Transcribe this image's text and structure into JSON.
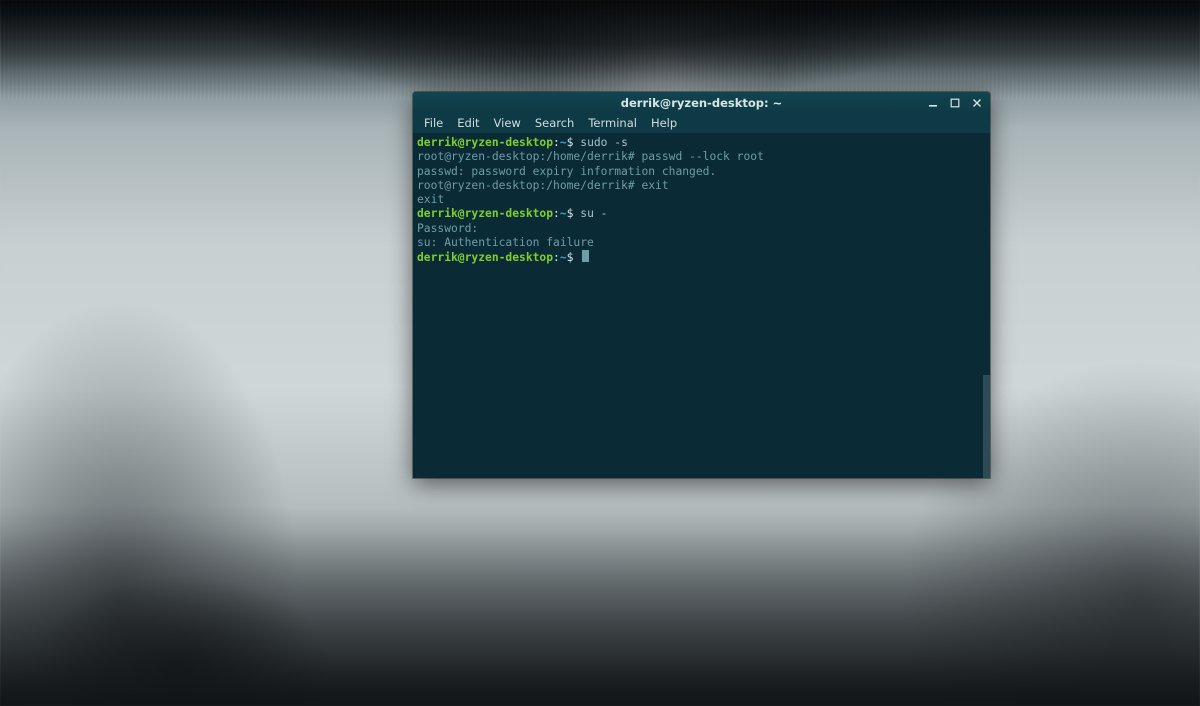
{
  "window": {
    "title": "derrik@ryzen-desktop: ~"
  },
  "menu": {
    "items": [
      "File",
      "Edit",
      "View",
      "Search",
      "Terminal",
      "Help"
    ]
  },
  "prompt": {
    "user": "derrik@ryzen-desktop",
    "sep": ":",
    "path": "~",
    "dollar": "$"
  },
  "lines": [
    {
      "type": "prompt",
      "cmd": " sudo -s"
    },
    {
      "type": "out",
      "text": "root@ryzen-desktop:/home/derrik# passwd --lock root"
    },
    {
      "type": "out",
      "text": "passwd: password expiry information changed."
    },
    {
      "type": "out",
      "text": "root@ryzen-desktop:/home/derrik# exit"
    },
    {
      "type": "out",
      "text": "exit"
    },
    {
      "type": "prompt",
      "cmd": " su -"
    },
    {
      "type": "out",
      "text": "Password: "
    },
    {
      "type": "out",
      "text": "su: Authentication failure"
    },
    {
      "type": "prompt_cursor",
      "cmd": " "
    }
  ],
  "colors": {
    "terminal_bg": "#0a2b36",
    "user_green": "#7fce2e",
    "path_blue": "#3aa0c9",
    "output_gray": "#6d9da6"
  }
}
